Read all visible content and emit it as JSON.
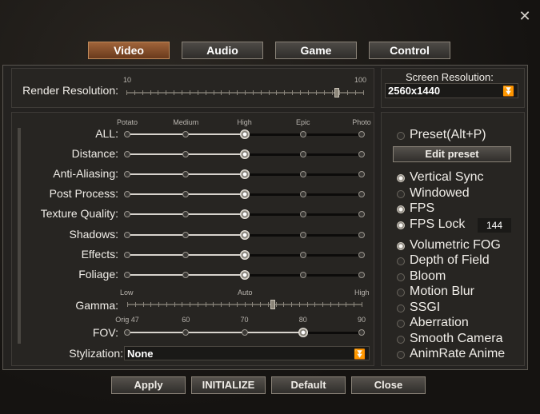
{
  "window": {
    "close_glyph": "✕"
  },
  "tabs": [
    {
      "label": "Video",
      "active": true
    },
    {
      "label": "Audio",
      "active": false
    },
    {
      "label": "Game",
      "active": false
    },
    {
      "label": "Control",
      "active": false
    }
  ],
  "render_resolution": {
    "label": "Render Resolution:",
    "min_label": "10",
    "max_label": "100",
    "value": 90
  },
  "screen_resolution": {
    "label": "Screen Resolution:",
    "value": "2560x1440",
    "chevron": "⏬"
  },
  "quality_ticks": [
    "Potato",
    "Medium",
    "High",
    "Epic",
    "Photo"
  ],
  "quality_settings": [
    {
      "label": "ALL:",
      "level": "High"
    },
    {
      "label": "Distance:",
      "level": "High"
    },
    {
      "label": "Anti-Aliasing:",
      "level": "High"
    },
    {
      "label": "Post Process:",
      "level": "High"
    },
    {
      "label": "Texture Quality:",
      "level": "High"
    },
    {
      "label": "Shadows:",
      "level": "High"
    },
    {
      "label": "Effects:",
      "level": "High"
    },
    {
      "label": "Foliage:",
      "level": "High"
    }
  ],
  "gamma": {
    "label": "Gamma:",
    "ticks": [
      "Low",
      "Auto",
      "High"
    ],
    "value_fraction": 0.62
  },
  "fov": {
    "label": "FOV:",
    "ticks": [
      "Orig 47",
      "60",
      "70",
      "80",
      "90"
    ],
    "value": "80"
  },
  "stylization": {
    "label": "Stylization:",
    "value": "None",
    "chevron": "⏬"
  },
  "preset": {
    "label": "Preset(Alt+P)",
    "checked": false,
    "edit_button": "Edit preset"
  },
  "options": [
    {
      "label": "Vertical Sync",
      "checked": true
    },
    {
      "label": "Windowed",
      "checked": false
    },
    {
      "label": "FPS",
      "checked": true
    },
    {
      "label": "FPS Lock",
      "checked": true,
      "value": "144"
    },
    {
      "label": "Volumetric FOG",
      "checked": true
    },
    {
      "label": "Depth of Field",
      "checked": false
    },
    {
      "label": "Bloom",
      "checked": false
    },
    {
      "label": "Motion Blur",
      "checked": false
    },
    {
      "label": "SSGI",
      "checked": false
    },
    {
      "label": "Aberration",
      "checked": false
    },
    {
      "label": "Smooth Camera",
      "checked": false
    },
    {
      "label": "AnimRate Anime",
      "checked": false
    }
  ],
  "footer_buttons": [
    "Apply",
    "INITIALIZE",
    "Default",
    "Close"
  ]
}
